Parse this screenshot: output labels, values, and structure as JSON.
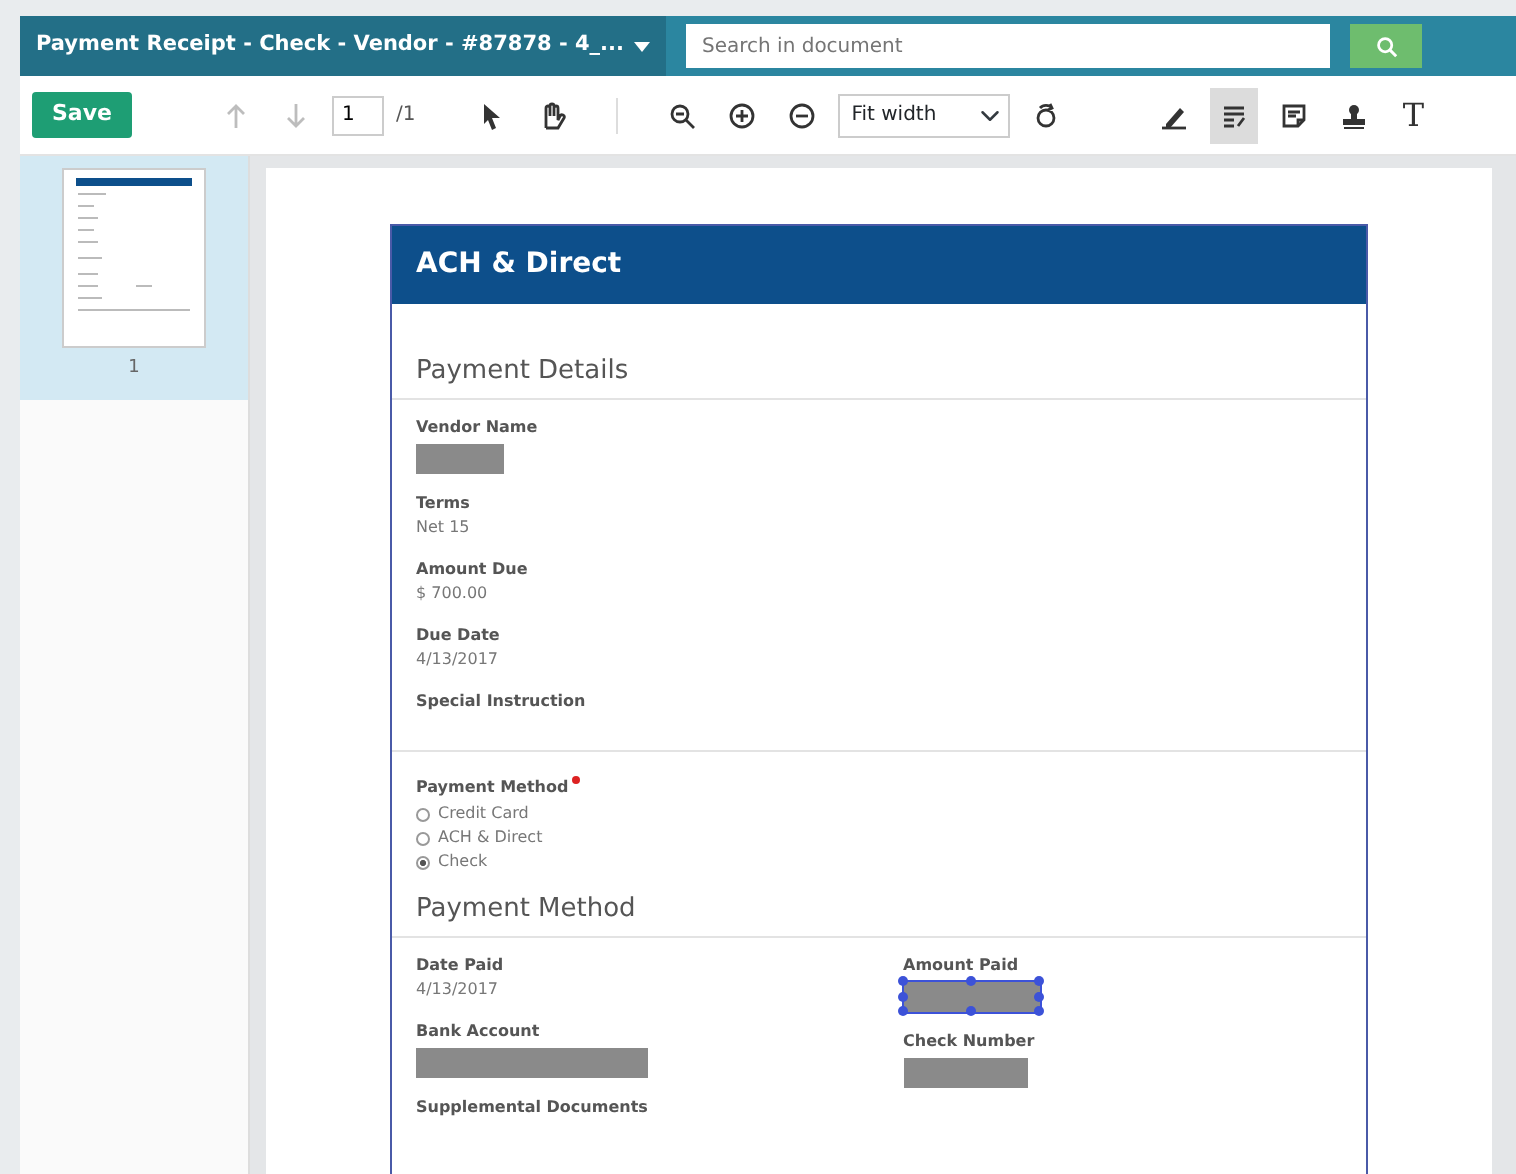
{
  "header": {
    "title": "Payment Receipt - Check - Vendor - #87878 - 4_...",
    "search": {
      "placeholder": "Search in document"
    }
  },
  "toolbar": {
    "save": "Save",
    "page": "1",
    "page_total": "/1",
    "zoom_mode": "Fit width",
    "nav_tools": [
      {
        "kind": "up",
        "disabled": true
      },
      {
        "kind": "down",
        "disabled": true
      }
    ],
    "view_tools": [
      {
        "kind": "pointer"
      },
      {
        "kind": "hand"
      },
      {
        "kind": "zoom"
      },
      {
        "kind": "zoomin"
      },
      {
        "kind": "zoomout"
      }
    ],
    "rotate_tool": {
      "kind": "rotate"
    },
    "annotate_tools": [
      {
        "kind": "pen",
        "selected": false
      },
      {
        "kind": "textselect",
        "selected": true
      },
      {
        "kind": "note",
        "selected": false
      },
      {
        "kind": "stamp",
        "selected": false
      },
      {
        "kind": "text",
        "selected": false,
        "label": "T"
      }
    ]
  },
  "thumbnails": [
    {
      "label": "1",
      "selected": true
    }
  ],
  "document": {
    "heading": "ACH & Direct",
    "sections": [
      {
        "title": "Payment Details",
        "fields": [
          {
            "label": "Vendor Name",
            "kind": "redacted"
          },
          {
            "label": "Terms",
            "value": "Net 15"
          },
          {
            "label": "Amount Due",
            "value": "$ 700.00"
          },
          {
            "label": "Due Date",
            "value": "4/13/2017"
          },
          {
            "label": "Special Instruction"
          }
        ]
      },
      {
        "radio": {
          "label": "Payment Method",
          "required": true,
          "options": [
            {
              "label": "Credit Card",
              "selected": false
            },
            {
              "label": "ACH & Direct",
              "selected": false
            },
            {
              "label": "Check",
              "selected": true
            }
          ]
        }
      },
      {
        "title": "Payment Method",
        "columns": [
          [
            {
              "label": "Date Paid",
              "value": "4/13/2017"
            },
            {
              "label": "Bank Account",
              "kind": "redacted"
            },
            {
              "label": "Supplemental Documents"
            }
          ],
          [
            {
              "label": "Amount Paid",
              "kind": "redacted",
              "selected": true
            },
            {
              "label": "Check Number",
              "kind": "redacted"
            }
          ]
        ]
      }
    ]
  }
}
